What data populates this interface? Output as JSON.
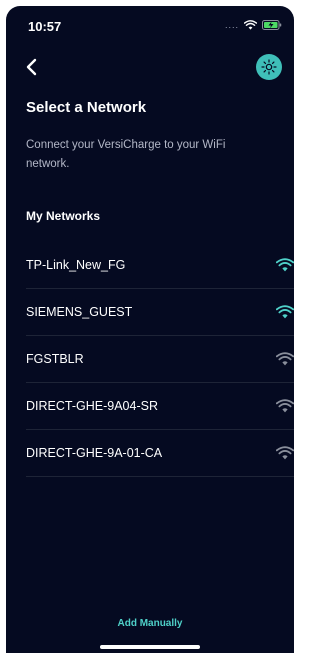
{
  "status_bar": {
    "time": "10:57",
    "carrier": "....",
    "icons": [
      "wifi-icon",
      "battery-charging-icon"
    ]
  },
  "nav": {
    "back_icon": "chevron-left-icon",
    "theme_icon": "sun-icon"
  },
  "page": {
    "title": "Select a Network",
    "subtitle": "Connect your VersiCharge to your WiFi network."
  },
  "networks": {
    "section_label": "My Networks",
    "items": [
      {
        "name": "TP-Link_New_FG",
        "signal": "strong"
      },
      {
        "name": "SIEMENS_GUEST",
        "signal": "strong"
      },
      {
        "name": "FGSTBLR",
        "signal": "weak"
      },
      {
        "name": "DIRECT-GHE-9A04-SR",
        "signal": "weak"
      },
      {
        "name": "DIRECT-GHE-9A-01-CA",
        "signal": "weak"
      }
    ]
  },
  "actions": {
    "add_manually": "Add Manually"
  },
  "colors": {
    "background": "#050a21",
    "accent": "#3fbfb9",
    "wifi_strong": "#4fd1c9",
    "wifi_weak": "#8a8f9c"
  }
}
